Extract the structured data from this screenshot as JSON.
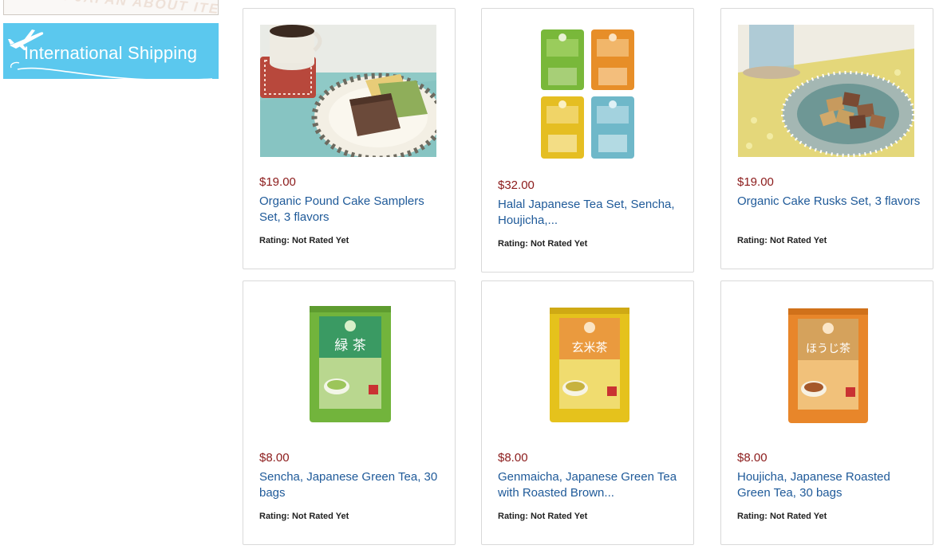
{
  "sidebar": {
    "top_banner_text": "SYSTEM JAPAN  ABOUT ITEM",
    "shipping_banner": "International Shipping"
  },
  "colors": {
    "price": "#8b1a1a",
    "title_link": "#1f5a99",
    "banner_bg": "#5bc8ee"
  },
  "products": [
    {
      "price": "$19.00",
      "title": "Organic Pound Cake Samplers Set, 3 flavors",
      "rating_label": "Rating:",
      "rating_value": "Not Rated Yet",
      "image": "pound-cake-photo"
    },
    {
      "price": "$32.00",
      "title": "Halal Japanese Tea Set, Sencha, Houjicha,...",
      "rating_label": "Rating:",
      "rating_value": "Not Rated Yet",
      "image": "tea-set-photo"
    },
    {
      "price": "$19.00",
      "title": "Organic Cake Rusks Set, 3 flavors",
      "rating_label": "Rating:",
      "rating_value": "Not Rated Yet",
      "image": "cake-rusks-photo"
    },
    {
      "price": "$8.00",
      "title": "Sencha, Japanese Green Tea, 30 bags",
      "rating_label": "Rating:",
      "rating_value": "Not Rated Yet",
      "image": "sencha-package-photo",
      "package_kanji": "緑 茶"
    },
    {
      "price": "$8.00",
      "title": "Genmaicha, Japanese Green Tea with Roasted Brown...",
      "rating_label": "Rating:",
      "rating_value": "Not Rated Yet",
      "image": "genmaicha-package-photo",
      "package_kanji": "玄米茶"
    },
    {
      "price": "$8.00",
      "title": "Houjicha, Japanese Roasted Green Tea, 30 bags",
      "rating_label": "Rating:",
      "rating_value": "Not Rated Yet",
      "image": "houjicha-package-photo",
      "package_kanji": "ほうじ茶"
    }
  ]
}
